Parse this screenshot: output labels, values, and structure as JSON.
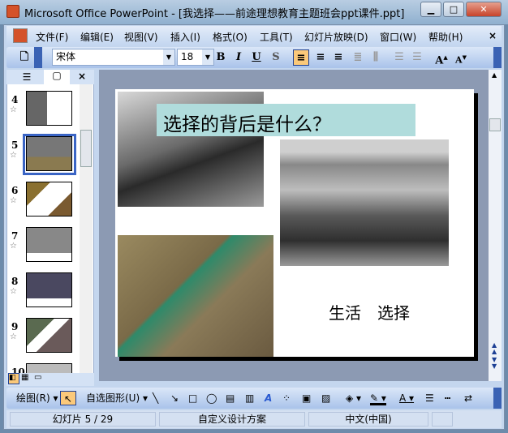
{
  "window": {
    "title": "Microsoft Office PowerPoint - [我选择——前途理想教育主题班会ppt课件.ppt]"
  },
  "menu": [
    "文件(F)",
    "编辑(E)",
    "视图(V)",
    "插入(I)",
    "格式(O)",
    "工具(T)",
    "幻灯片放映(D)",
    "窗口(W)",
    "帮助(H)"
  ],
  "toolbar": {
    "font": "宋体",
    "size": "18",
    "bold": "B",
    "italic": "I",
    "underline": "U",
    "shadow": "S"
  },
  "thumbnails": [
    {
      "num": "4"
    },
    {
      "num": "5"
    },
    {
      "num": "6"
    },
    {
      "num": "7"
    },
    {
      "num": "8"
    },
    {
      "num": "9"
    },
    {
      "num": "10"
    }
  ],
  "slide": {
    "title": "选择的背后是什么？",
    "caption": "生活　选择"
  },
  "draw": {
    "draw_label": "绘图(R)",
    "autoshapes_label": "自选图形(U)"
  },
  "status": {
    "slide": "幻灯片 5 / 29",
    "design": "自定义设计方案",
    "language": "中文(中国)"
  }
}
